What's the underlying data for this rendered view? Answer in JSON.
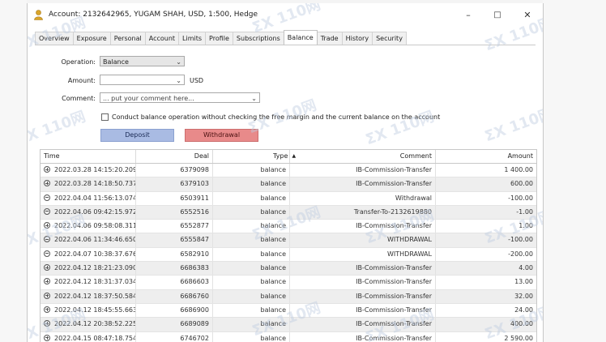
{
  "window": {
    "title": "Account: 2132642965, YUGAM SHAH, USD, 1:500, Hedge",
    "minimize": "–",
    "maximize": "□",
    "close": "✕"
  },
  "tabs": [
    {
      "label": "Overview"
    },
    {
      "label": "Exposure"
    },
    {
      "label": "Personal"
    },
    {
      "label": "Account"
    },
    {
      "label": "Limits"
    },
    {
      "label": "Profile"
    },
    {
      "label": "Subscriptions"
    },
    {
      "label": "Balance",
      "active": true
    },
    {
      "label": "Trade"
    },
    {
      "label": "History"
    },
    {
      "label": "Security"
    }
  ],
  "form": {
    "operation_label": "Operation:",
    "operation_value": "Balance",
    "amount_label": "Amount:",
    "amount_value": "",
    "amount_unit": "USD",
    "comment_label": "Comment:",
    "comment_placeholder": "... put your comment here...",
    "check_label": "Conduct balance operation without checking the free margin and the current balance on the account",
    "deposit_label": "Deposit",
    "withdrawal_label": "Withdrawal"
  },
  "table": {
    "headers": {
      "time": "Time",
      "deal": "Deal",
      "type": "Type",
      "sort": "▲",
      "comment": "Comment",
      "amount": "Amount"
    },
    "rows": [
      {
        "sign": "plus",
        "time": "2022.03.28 14:15:20.209",
        "deal": "6379098",
        "type": "balance",
        "comment": "IB-Commission-Transfer",
        "amount": "1 400.00"
      },
      {
        "sign": "plus",
        "time": "2022.03.28 14:18:50.737",
        "deal": "6379103",
        "type": "balance",
        "comment": "IB-Commission-Transfer",
        "amount": "600.00"
      },
      {
        "sign": "minus",
        "time": "2022.04.04 11:56:13.074",
        "deal": "6503911",
        "type": "balance",
        "comment": "Withdrawal",
        "amount": "-100.00"
      },
      {
        "sign": "minus",
        "time": "2022.04.06 09:42:15.972",
        "deal": "6552516",
        "type": "balance",
        "comment": "Transfer-To-2132619880",
        "amount": "-1.00"
      },
      {
        "sign": "plus",
        "time": "2022.04.06 09:58:08.311",
        "deal": "6552877",
        "type": "balance",
        "comment": "IB-Commission-Transfer",
        "amount": "1.00"
      },
      {
        "sign": "minus",
        "time": "2022.04.06 11:34:46.650",
        "deal": "6555847",
        "type": "balance",
        "comment": "WITHDRAWAL",
        "amount": "-100.00"
      },
      {
        "sign": "minus",
        "time": "2022.04.07 10:38:37.676",
        "deal": "6582910",
        "type": "balance",
        "comment": "WITHDRAWAL",
        "amount": "-200.00"
      },
      {
        "sign": "plus",
        "time": "2022.04.12 18:21:23.090",
        "deal": "6686383",
        "type": "balance",
        "comment": "IB-Commission-Transfer",
        "amount": "4.00"
      },
      {
        "sign": "plus",
        "time": "2022.04.12 18:31:37.034",
        "deal": "6686603",
        "type": "balance",
        "comment": "IB-Commission-Transfer",
        "amount": "13.00"
      },
      {
        "sign": "plus",
        "time": "2022.04.12 18:37:50.584",
        "deal": "6686760",
        "type": "balance",
        "comment": "IB-Commission-Transfer",
        "amount": "32.00"
      },
      {
        "sign": "plus",
        "time": "2022.04.12 18:45:55.663",
        "deal": "6686900",
        "type": "balance",
        "comment": "IB-Commission-Transfer",
        "amount": "24.00"
      },
      {
        "sign": "plus",
        "time": "2022.04.12 20:38:52.225",
        "deal": "6689089",
        "type": "balance",
        "comment": "IB-Commission-Transfer",
        "amount": "400.00"
      },
      {
        "sign": "plus",
        "time": "2022.04.15 08:47:18.754",
        "deal": "6746702",
        "type": "balance",
        "comment": "IB-Commission-Transfer",
        "amount": "2 590.00"
      }
    ]
  },
  "colors": {
    "deposit": "#a9bbe3",
    "withdrawal": "#e88a8a",
    "icon_gold": "#d9a52b"
  },
  "watermark_text": "ΣX 110网"
}
